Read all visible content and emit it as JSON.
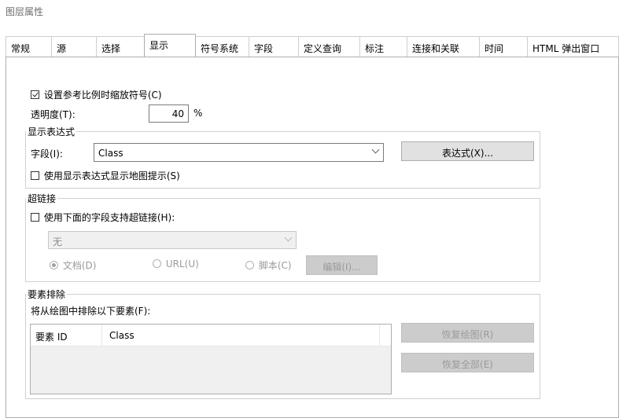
{
  "window": {
    "title": "图层属性"
  },
  "tabs": [
    {
      "label": "常规"
    },
    {
      "label": "源"
    },
    {
      "label": "选择"
    },
    {
      "label": "显示"
    },
    {
      "label": "符号系统"
    },
    {
      "label": "字段"
    },
    {
      "label": "定义查询"
    },
    {
      "label": "标注"
    },
    {
      "label": "连接和关联"
    },
    {
      "label": "时间"
    },
    {
      "label": "HTML 弹出窗口"
    }
  ],
  "display": {
    "scale_symbols_label": "设置参考比例时缩放符号(C)",
    "scale_symbols_checked": true,
    "transparency_label": "透明度(T):",
    "transparency_value": "40",
    "transparency_unit": "%"
  },
  "expression": {
    "group_label": "显示表达式",
    "field_label": "字段(I):",
    "field_value": "Class",
    "expression_button": "表达式(X)...",
    "map_tips_label": "使用显示表达式显示地图提示(S)",
    "map_tips_checked": false
  },
  "hyperlinks": {
    "group_label": "超链接",
    "support_label": "使用下面的字段支持超链接(H):",
    "support_checked": false,
    "field_value": "无",
    "radio_document": "文档(D)",
    "radio_url": "URL(U)",
    "radio_script": "脚本(C)",
    "edit_button": "编辑(I)..."
  },
  "exclusion": {
    "group_label": "要素排除",
    "description": "将从绘图中排除以下要素(F):",
    "columns": [
      "要素 ID",
      "Class"
    ],
    "restore_drawing_button": "恢复绘图(R)",
    "restore_all_button": "恢复全部(E)"
  }
}
